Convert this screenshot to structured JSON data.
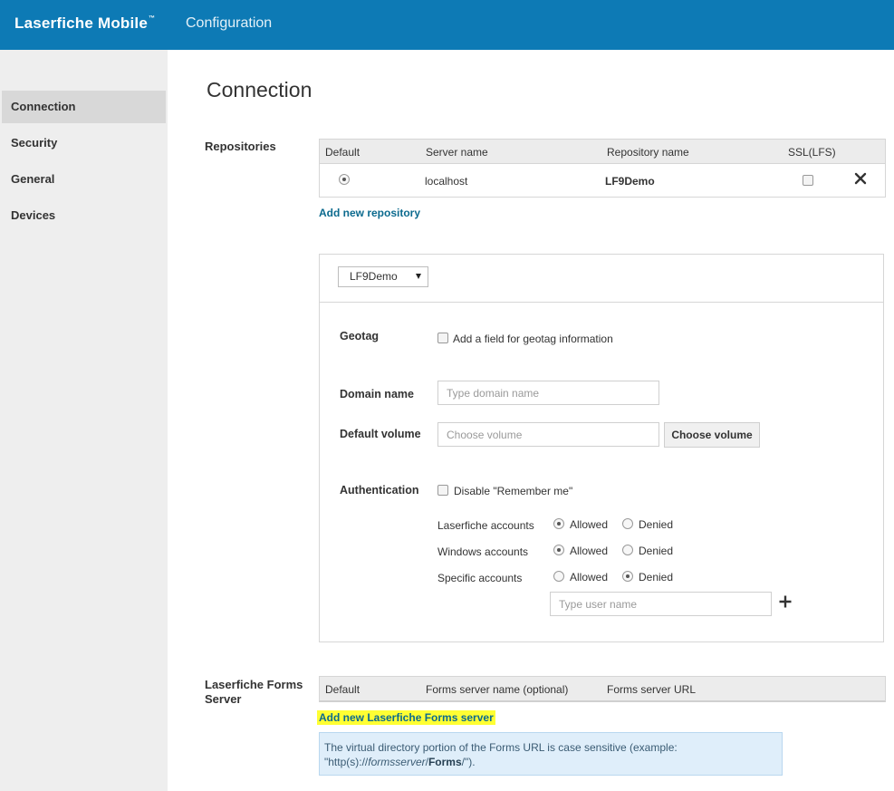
{
  "header": {
    "brand": "Laserfiche Mobile",
    "brand_mark": "™",
    "section": "Configuration"
  },
  "sidebar": {
    "items": [
      {
        "label": "Connection",
        "active": true
      },
      {
        "label": "Security"
      },
      {
        "label": "General"
      },
      {
        "label": "Devices"
      }
    ]
  },
  "page_title": "Connection",
  "repositories": {
    "label": "Repositories",
    "columns": [
      "Default",
      "Server name",
      "Repository name",
      "SSL(LFS)"
    ],
    "rows": [
      {
        "default": true,
        "server_name": "localhost",
        "repository_name": "LF9Demo",
        "ssl": false
      }
    ],
    "add_link": "Add new repository"
  },
  "repo_settings": {
    "selected_repo": "LF9Demo",
    "geotag": {
      "label": "Geotag",
      "checkbox_label": "Add a field for geotag information",
      "checked": false
    },
    "domain_name": {
      "label": "Domain name",
      "placeholder": "Type domain name",
      "value": ""
    },
    "default_volume": {
      "label": "Default volume",
      "placeholder": "Choose volume",
      "value": "",
      "button": "Choose volume"
    },
    "authentication": {
      "label": "Authentication",
      "remember_label": "Disable \"Remember me\"",
      "remember_checked": false,
      "allowed_label": "Allowed",
      "denied_label": "Denied",
      "accounts": [
        {
          "label": "Laserfiche accounts",
          "value": "Allowed"
        },
        {
          "label": "Windows accounts",
          "value": "Allowed"
        },
        {
          "label": "Specific accounts",
          "value": "Denied"
        }
      ],
      "user_placeholder": "Type user name"
    }
  },
  "forms_server": {
    "label_line1": "Laserfiche Forms",
    "label_line2": "Server",
    "columns": [
      "Default",
      "Forms server name (optional)",
      "Forms server URL"
    ],
    "add_link": "Add new Laserfiche Forms server",
    "info": {
      "text1": "The virtual directory portion of the Forms URL is case sensitive (example:",
      "text2_prefix": "\"http(s)://",
      "text2_italic": "formsserver",
      "text2_slash": "/",
      "text2_bold": "Forms",
      "text2_suffix": "/\")."
    }
  },
  "icons": {
    "remove": "close-icon",
    "add_user": "plus-icon",
    "dropdown": "chevron-down-icon"
  },
  "colors": {
    "header_bg": "#0d7ab5",
    "link": "#0b6a8e",
    "highlight": "#ffff33",
    "info_bg": "#dfeefa"
  }
}
